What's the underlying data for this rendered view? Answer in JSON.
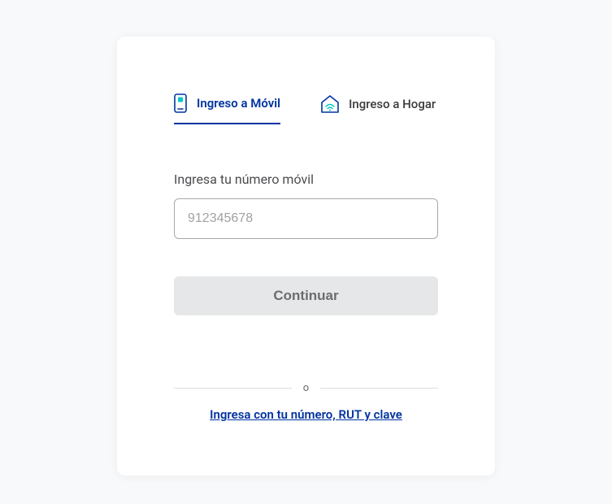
{
  "tabs": {
    "movil": {
      "label": "Ingreso a Móvil"
    },
    "hogar": {
      "label": "Ingreso a Hogar"
    }
  },
  "form": {
    "phone_label": "Ingresa tu número móvil",
    "phone_placeholder": "912345678",
    "phone_value": "",
    "continue_label": "Continuar"
  },
  "divider": {
    "text": "o"
  },
  "alt_link": {
    "label": "Ingresa con tu número, RUT y clave"
  },
  "colors": {
    "primary": "#0033a0",
    "accent": "#00c8c8"
  }
}
